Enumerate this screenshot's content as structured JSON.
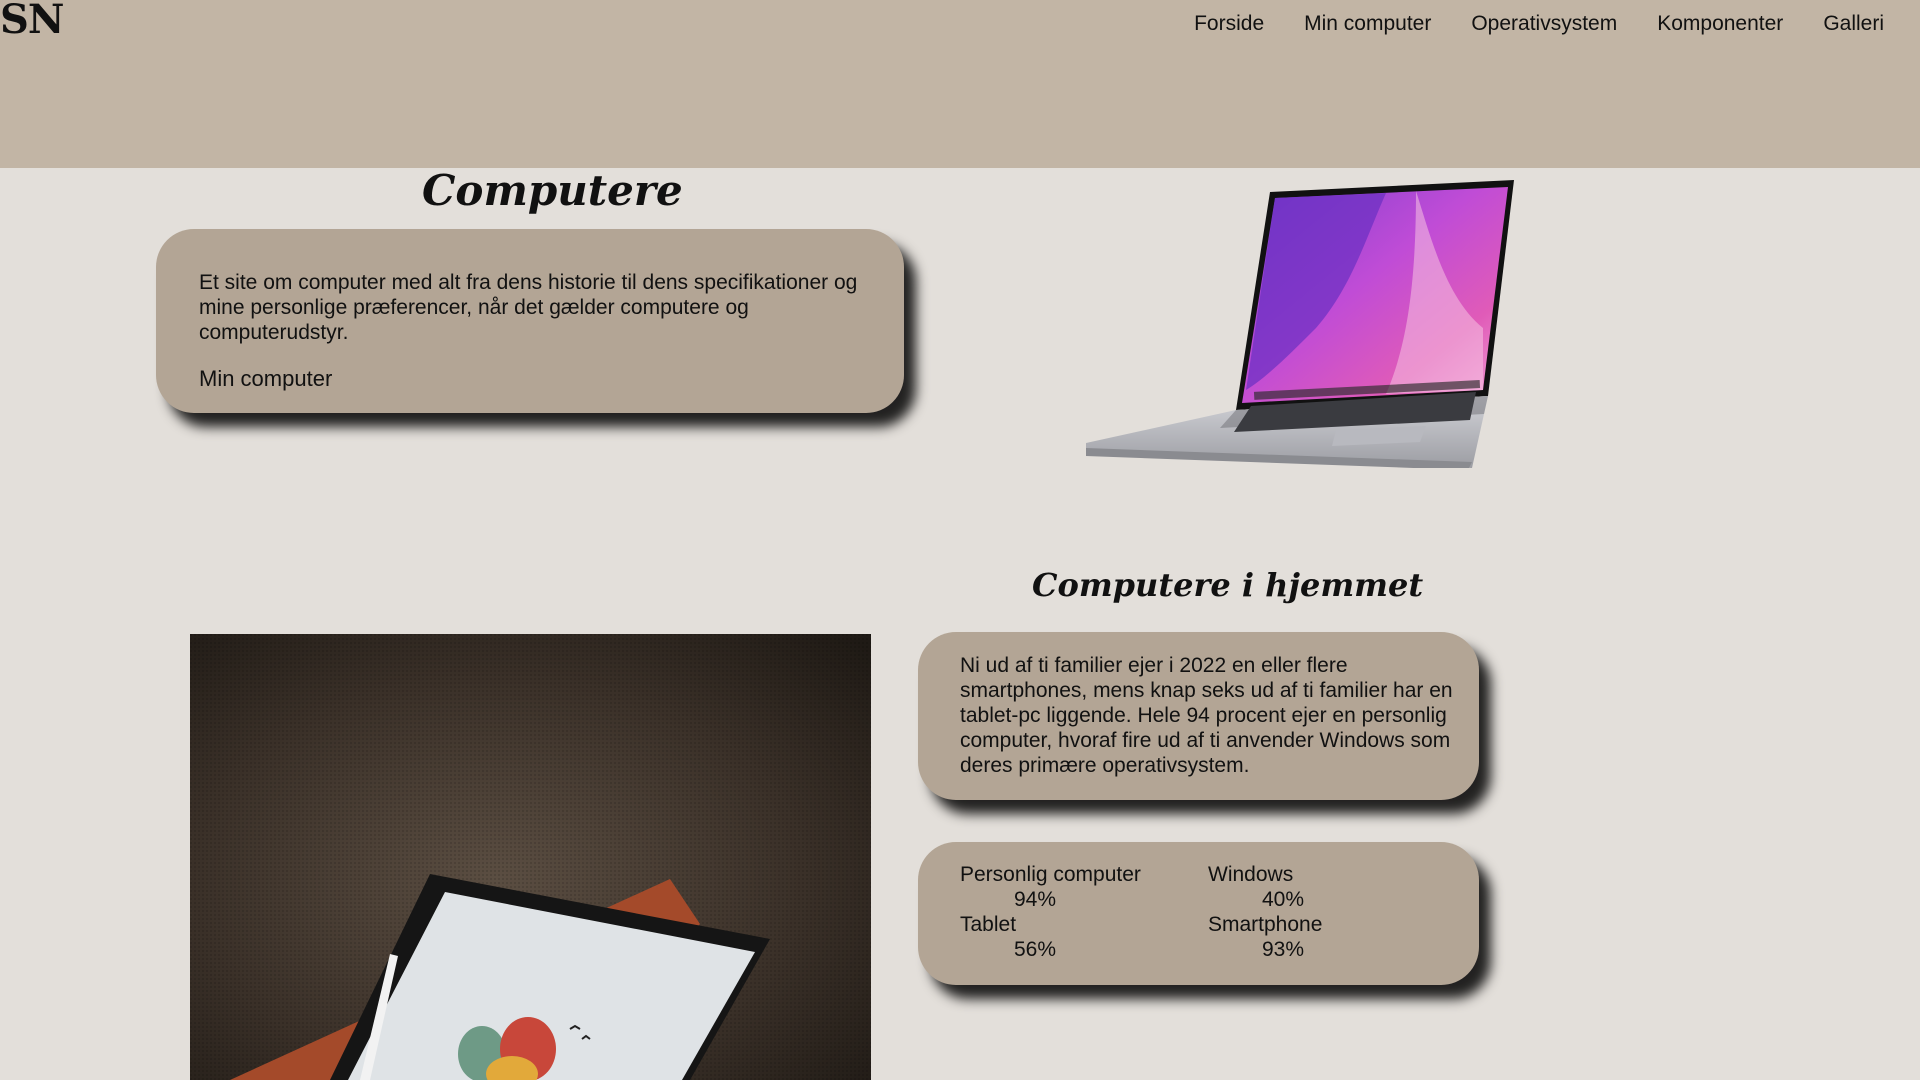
{
  "header": {
    "logo": "SN",
    "nav": [
      "Forside",
      "Min computer",
      "Operativsystem",
      "Komponenter",
      "Galleri"
    ]
  },
  "intro": {
    "title": "Computere",
    "text": "Et site om computer med alt fra dens historie til dens specifikationer og mine personlige præferencer, når det gælder computere og computerudstyr.",
    "link": "Min computer"
  },
  "home": {
    "title": "Computere i hjemmet",
    "text": "Ni ud af ti familier ejer i 2022 en eller flere smartphones, mens knap seks ud af ti familier har en tablet-pc liggende. Hele 94 procent ejer en personlig computer, hvoraf fire ud af ti anvender Windows som deres primære operativsystem.",
    "stats": [
      {
        "label": "Personlig computer",
        "value": "94%"
      },
      {
        "label": "Windows",
        "value": "40%"
      },
      {
        "label": "Tablet",
        "value": "56%"
      },
      {
        "label": "Smartphone",
        "value": "93%"
      }
    ]
  },
  "colors": {
    "header_bg": "#c2b5a5",
    "page_bg": "#e3dfda",
    "card_bg": "#b3a595"
  }
}
